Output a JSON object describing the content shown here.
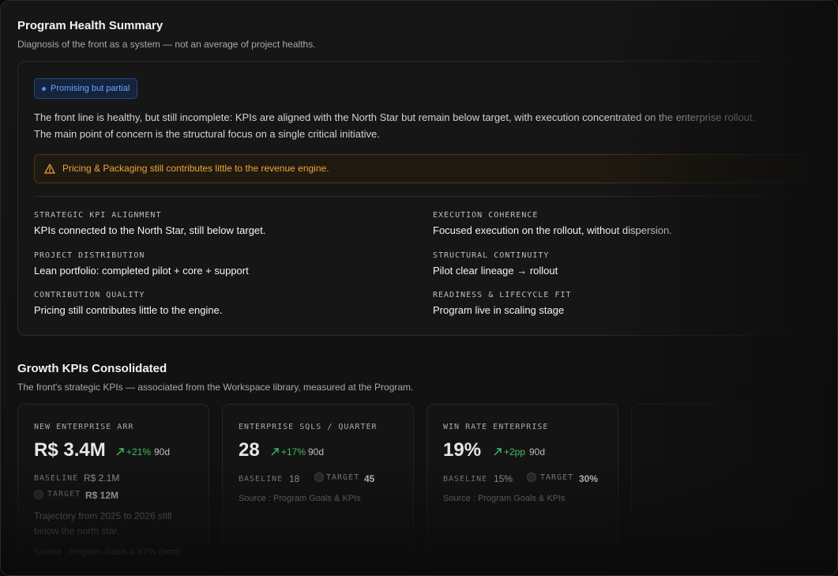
{
  "health": {
    "title": "Program Health Summary",
    "subtitle": "Diagnosis of the front as a system — not an average of project healths.",
    "badge": "Promising but partial",
    "summary_line1": "The front line is healthy, but still incomplete: KPIs are aligned with the North Star but remain below target, with execution concentrated on the enterprise rollout.",
    "summary_line2": "The main point of concern is the structural focus on a single critical initiative.",
    "warning": "Pricing & Packaging still contributes little to the revenue engine.",
    "metrics": [
      {
        "label": "STRATEGIC KPI ALIGNMENT",
        "value": "KPIs connected to the North Star, still below target."
      },
      {
        "label": "EXECUTION COHERENCE",
        "value": "Focused execution on the rollout, without dispersion."
      },
      {
        "label": "PROJECT DISTRIBUTION",
        "value": "Lean portfolio: completed pilot + core + support"
      },
      {
        "label": "STRUCTURAL CONTINUITY",
        "value": "Pilot clear lineage → rollout"
      },
      {
        "label": "CONTRIBUTION QUALITY",
        "value": "Pricing still contributes little to the engine."
      },
      {
        "label": "READINESS & LIFECYCLE FIT",
        "value": "Program live in scaling stage"
      }
    ]
  },
  "kpis": {
    "title": "Growth KPIs Consolidated",
    "subtitle": "The front's strategic KPIs — associated from the Workspace library, measured at the Program.",
    "cards": [
      {
        "name": "NEW ENTERPRISE ARR",
        "value": "R$ 3.4M",
        "delta": "+21%",
        "period": "90d",
        "baseline_label": "BASELINE",
        "baseline": "R$ 2.1M",
        "target_label": "TARGET",
        "target": "R$ 12M",
        "note": "Trajectory from 2025 to 2026 still below the north star.",
        "source": "Source : Program Goals & KPIs (north"
      },
      {
        "name": "ENTERPRISE SQLS / QUARTER",
        "value": "28",
        "delta": "+17%",
        "period": "90d",
        "baseline_label": "BASELINE",
        "baseline": "18",
        "target_label": "TARGET",
        "target": "45",
        "source": "Source : Program Goals & KPIs"
      },
      {
        "name": "WIN RATE ENTERPRISE",
        "value": "19%",
        "delta": "+2pp",
        "period": "90d",
        "baseline_label": "BASELINE",
        "baseline": "15%",
        "target_label": "TARGET",
        "target": "30%",
        "source": "Source : Program Goals & KPIs"
      }
    ]
  },
  "colors": {
    "accent_blue": "#6aa3ff",
    "warning_amber": "#f0a33a",
    "positive_green": "#3fbf5f"
  }
}
